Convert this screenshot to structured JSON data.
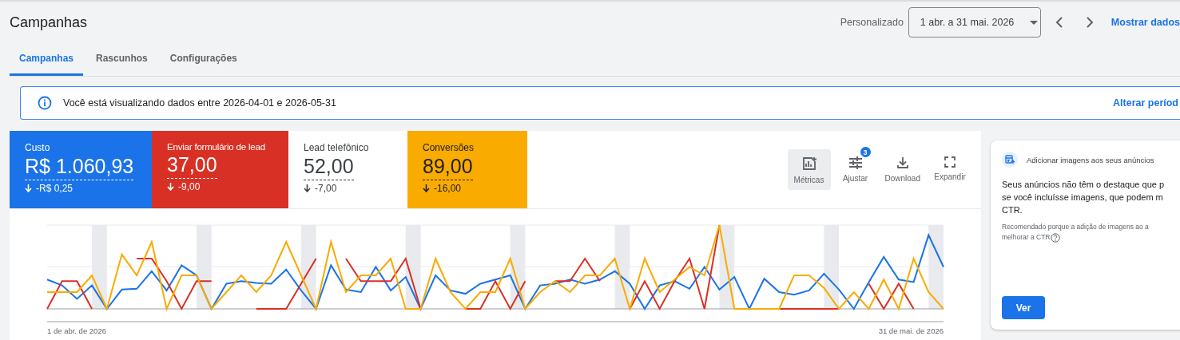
{
  "page_title": "Campanhas",
  "date_range": {
    "preset": "Personalizado",
    "value": "1 abr. a 31 mai. 2026"
  },
  "show_data_link": "Mostrar dados",
  "tabs": [
    {
      "label": "Campanhas",
      "selected": true
    },
    {
      "label": "Rascunhos",
      "selected": false
    },
    {
      "label": "Configurações",
      "selected": false
    }
  ],
  "info_banner": {
    "text": "Você está visualizando dados entre 2026-04-01 e 2026-05-31",
    "link": "Alterar períod"
  },
  "scorecards": [
    {
      "label": "Custo",
      "value": "R$ 1.060,93",
      "change": "-R$ 0,25",
      "selected": true,
      "color": "#1a73e8"
    },
    {
      "label": "Enviar formulário de lead",
      "value": "37,00",
      "change": "-9,00",
      "selected": true,
      "color": "#d93025"
    },
    {
      "label": "Lead telefônico",
      "value": "52,00",
      "change": "-7,00",
      "selected": false
    },
    {
      "label": "Conversões",
      "value": "89,00",
      "change": "-16,00",
      "selected": true,
      "color": "#f9ab00"
    }
  ],
  "toolbar": [
    {
      "kind": "metrics",
      "label": "Métricas",
      "selected": true
    },
    {
      "kind": "adjust",
      "label": "Ajustar",
      "selected": false,
      "badge": "3"
    },
    {
      "kind": "download",
      "label": "Download",
      "selected": false
    },
    {
      "kind": "expand",
      "label": "Expandir",
      "selected": false
    }
  ],
  "chart": {
    "start_label": "1 de abr. de 2026",
    "end_label": "31 de mai. de 2026"
  },
  "recommendation": {
    "title": "Adicionar imagens aos seus anúncios",
    "body_lines": [
      "Seus anúncios não têm o destaque que p",
      "se você incluísse imagens, que podem m",
      "CTR."
    ],
    "reason_lines": [
      "Recomendado porque a adição de imagens ao a",
      "melhorar a CTR"
    ],
    "button": "Ver"
  }
}
